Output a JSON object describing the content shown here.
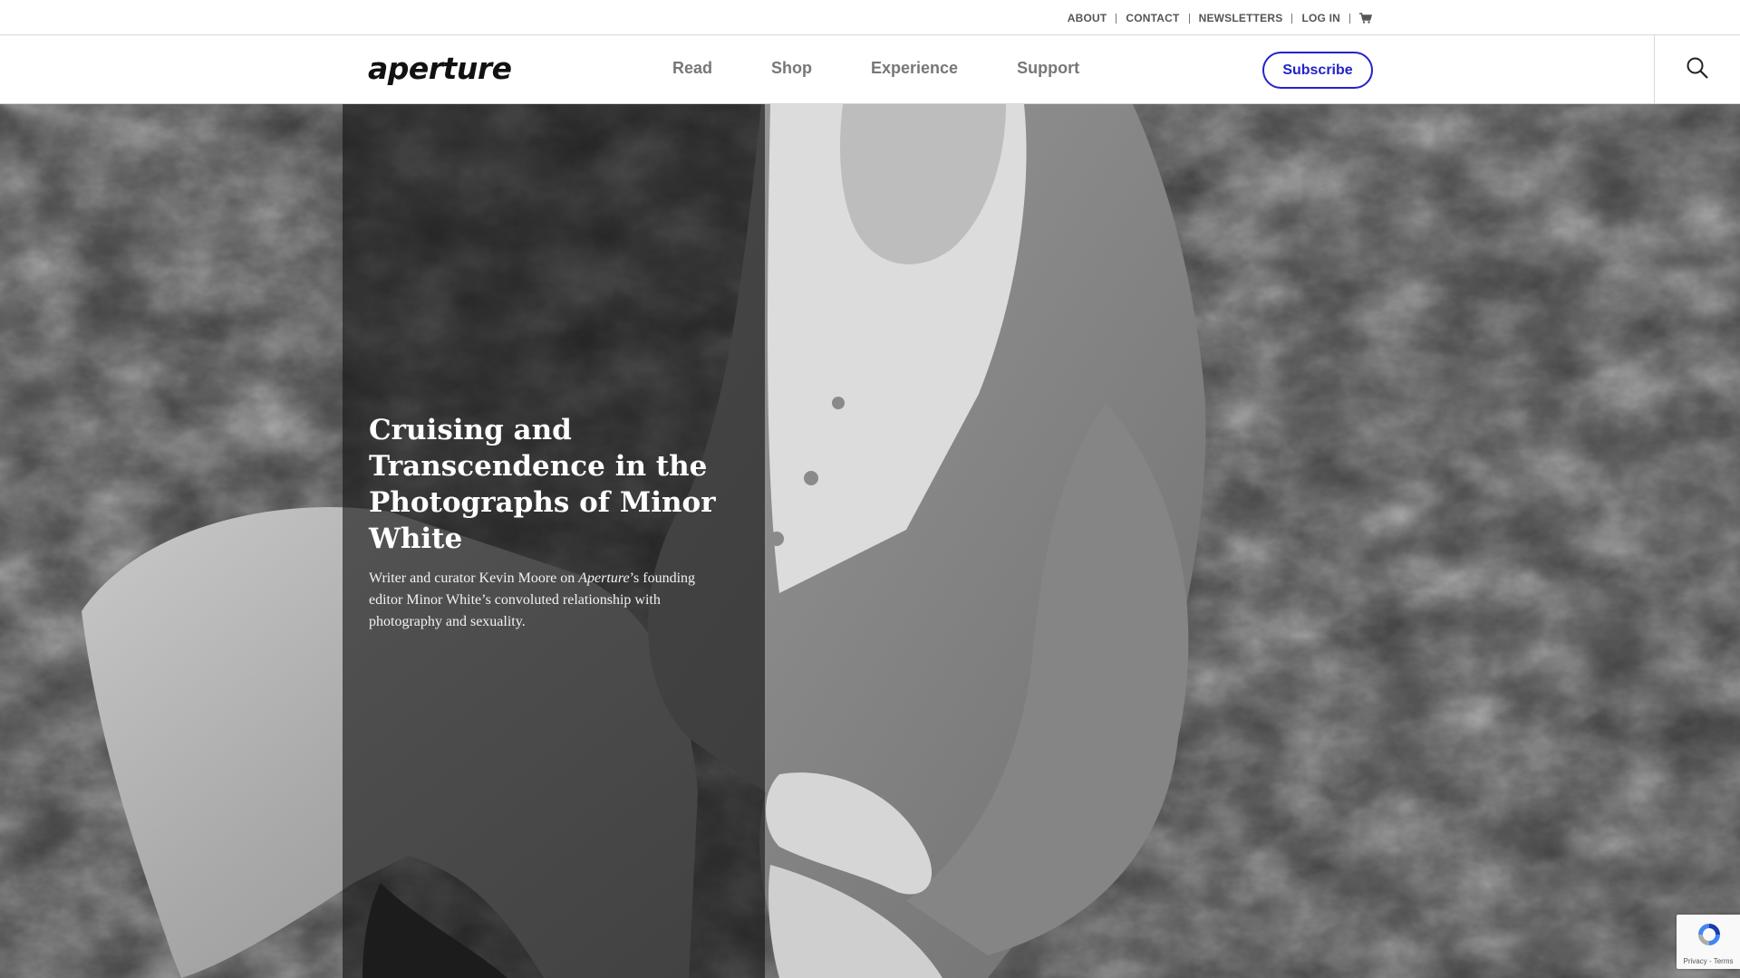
{
  "utility": {
    "links": [
      "ABOUT",
      "CONTACT",
      "NEWSLETTERS",
      "LOG IN"
    ]
  },
  "nav": {
    "logo": "aperture",
    "items": [
      "Read",
      "Shop",
      "Experience",
      "Support"
    ],
    "subscribe_label": "Subscribe"
  },
  "hero": {
    "title": "Cruising and Transcendence in the Photographs of Minor White",
    "description_before": "Writer and curator Kevin Moore on ",
    "description_emphasis": "Aperture",
    "description_after": "’s founding editor Minor White’s convoluted relationship with photography and sexuality."
  },
  "recaptcha": {
    "footer": "Privacy - Terms"
  },
  "colors": {
    "accent": "#2323c8",
    "nav_text": "#777777",
    "utility_text": "#555555"
  },
  "icons": {
    "cart": "cart-icon",
    "search": "search-icon",
    "recaptcha": "recaptcha-icon"
  }
}
